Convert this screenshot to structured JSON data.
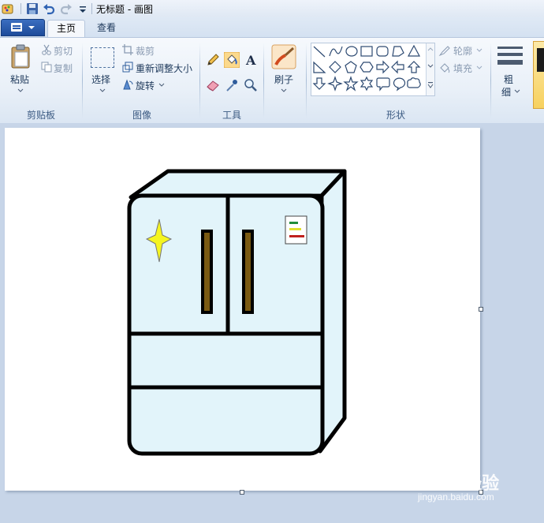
{
  "window": {
    "title": "无标题 - 画图"
  },
  "tabs": [
    {
      "label": "主页",
      "active": true
    },
    {
      "label": "查看",
      "active": false
    }
  ],
  "clipboard": {
    "paste_label": "粘贴",
    "cut_label": "剪切",
    "copy_label": "复制",
    "group_label": "剪贴板"
  },
  "image": {
    "select_label": "选择",
    "crop_label": "裁剪",
    "resize_label": "重新调整大小",
    "rotate_label": "旋转",
    "group_label": "图像"
  },
  "tools": {
    "group_label": "工具",
    "items": [
      "pencil-icon",
      "fill-bucket-icon",
      "text-icon",
      "eraser-icon",
      "color-picker-icon",
      "magnifier-icon"
    ]
  },
  "brushes": {
    "label": "刷子"
  },
  "shapes": {
    "group_label": "形状",
    "outline_label": "轮廓",
    "fill_label": "填充",
    "items": [
      "line",
      "curve",
      "oval",
      "rectangle",
      "rounded-rectangle",
      "polygon",
      "triangle",
      "right-triangle",
      "diamond",
      "pentagon",
      "hexagon",
      "arrow-right",
      "arrow-left",
      "arrow-up",
      "arrow-down",
      "star-four",
      "star-five",
      "star-six",
      "callout-rounded",
      "callout-oval",
      "callout-cloud"
    ]
  },
  "size": {
    "label_line1": "粗",
    "label_line2": "细"
  },
  "watermark": {
    "line1": "Baidu经验",
    "line2": "jingyan.baidu.com"
  },
  "colors": {
    "fridge_fill": "#e2f4fa",
    "outline": "#000000",
    "handle": "#7a5a12",
    "sparkle": "#f5f520",
    "label_green": "#1f8c3a",
    "label_yellow": "#e0e030",
    "label_red": "#c0201d"
  }
}
